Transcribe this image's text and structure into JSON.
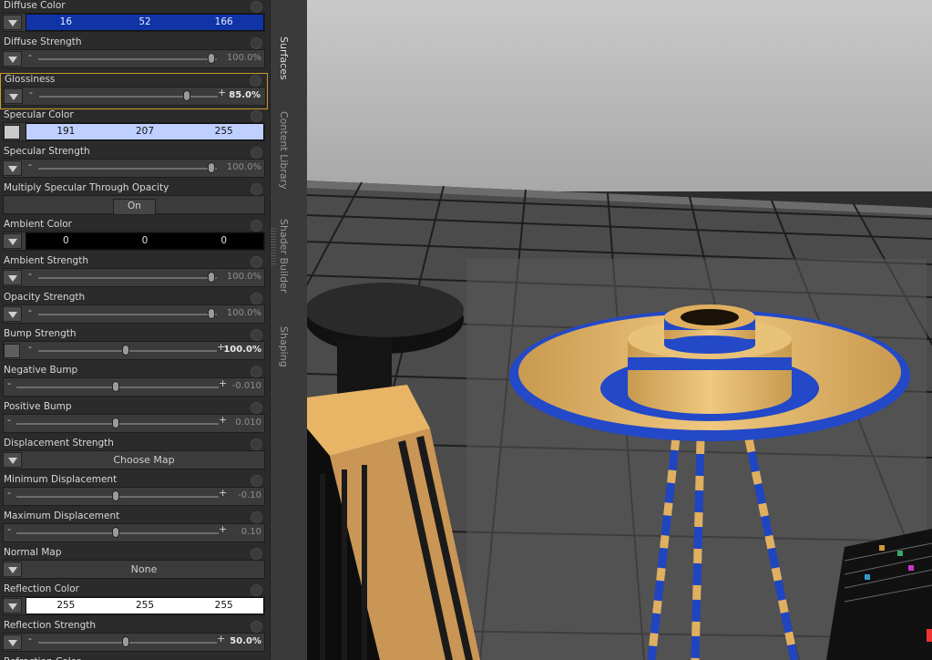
{
  "surfaces": {
    "properties": [
      {
        "label": "Diffuse Color",
        "type": "color",
        "values": [
          "16",
          "52",
          "166"
        ],
        "background": "#1034a6",
        "text_color": "#e8ecff"
      },
      {
        "label": "Diffuse Strength",
        "type": "slider",
        "value_text": "100.0%",
        "level": 1.0
      },
      {
        "label": "Glossiness",
        "type": "slider",
        "value_text": "85.0%",
        "level": 0.85,
        "selected": true,
        "emphasis": true
      },
      {
        "label": "Specular Color",
        "type": "color",
        "values": [
          "191",
          "207",
          "255"
        ],
        "background": "#bfcfff",
        "text_color": "#101010",
        "swatch": "#c9c9c9"
      },
      {
        "label": "Specular Strength",
        "type": "slider",
        "value_text": "100.0%",
        "level": 1.0
      },
      {
        "label": "Multiply Specular Through Opacity",
        "type": "toggle",
        "value_text": "On"
      },
      {
        "label": "Ambient Color",
        "type": "color",
        "values": [
          "0",
          "0",
          "0"
        ],
        "background": "#000000",
        "text_color": "#e0e0e0"
      },
      {
        "label": "Ambient Strength",
        "type": "slider",
        "value_text": "100.0%",
        "level": 1.0
      },
      {
        "label": "Opacity Strength",
        "type": "slider",
        "value_text": "100.0%",
        "level": 1.0
      },
      {
        "label": "Bump Strength",
        "type": "slider",
        "value_text": "100.0%",
        "level": 0.5,
        "emphasis": true,
        "swatch": "#5e5e5e"
      },
      {
        "label": "Negative Bump",
        "type": "slider",
        "value_text": "-0.010",
        "level": 0.5,
        "no_dropdown": true
      },
      {
        "label": "Positive Bump",
        "type": "slider",
        "value_text": "0.010",
        "level": 0.5,
        "no_dropdown": true
      },
      {
        "label": "Displacement Strength",
        "type": "map",
        "value_text": "Choose Map"
      },
      {
        "label": "Minimum Displacement",
        "type": "slider",
        "value_text": "-0.10",
        "level": 0.5,
        "no_dropdown": true
      },
      {
        "label": "Maximum Displacement",
        "type": "slider",
        "value_text": "0.10",
        "level": 0.5,
        "no_dropdown": true
      },
      {
        "label": "Normal Map",
        "type": "map",
        "value_text": "None"
      },
      {
        "label": "Reflection Color",
        "type": "color",
        "values": [
          "255",
          "255",
          "255"
        ],
        "background": "#ffffff",
        "text_color": "#101010"
      },
      {
        "label": "Reflection Strength",
        "type": "slider",
        "value_text": "50.0%",
        "level": 0.5,
        "emphasis": true
      },
      {
        "label": "Refraction Color",
        "type": "partial"
      }
    ]
  },
  "side_tabs": [
    {
      "label": "Surfaces",
      "active": true
    },
    {
      "label": "Content Library",
      "active": false
    },
    {
      "label": "Shader Builder",
      "active": false
    },
    {
      "label": "Shaping",
      "active": false
    }
  ],
  "viewport": {
    "background": "#b9b9b9",
    "floor_color": "#4a4a4a",
    "grid_color": "#1c1c1c",
    "accent_gold": "#e0b060",
    "accent_blue": "#2045c0"
  }
}
